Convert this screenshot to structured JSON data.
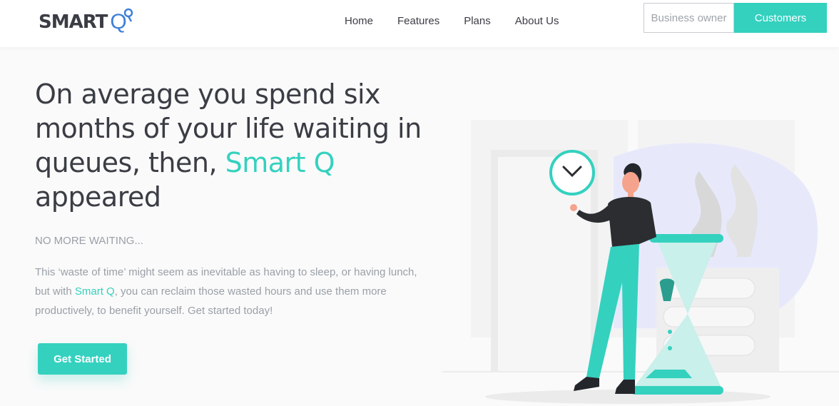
{
  "brand": {
    "logo_text": "SMART",
    "logo_q": "Q",
    "accent_color": "#34d1bf",
    "logo_q_color": "#3f7fd8"
  },
  "nav": {
    "items": [
      {
        "label": "Home"
      },
      {
        "label": "Features"
      },
      {
        "label": "Plans"
      },
      {
        "label": "About Us"
      }
    ]
  },
  "auth": {
    "business_label": "Business owner",
    "customers_label": "Customers"
  },
  "hero": {
    "title_part1": "On average you spend six months of your life waiting in queues, then, ",
    "title_accent": "Smart Q",
    "title_part2": " appeared",
    "tagline": "NO MORE WAITING...",
    "desc_part1": "This ‘waste of time’ might seem as inevitable as having to sleep, or having lunch, but with ",
    "desc_accent": "Smart Q",
    "desc_part2": ", you can reclaim those wasted hours and use them more productively, to benefit yourself. Get started today!",
    "cta_label": "Get Started"
  },
  "illustration": {
    "icons": [
      "clock-icon",
      "hourglass-icon",
      "person-figure"
    ]
  }
}
